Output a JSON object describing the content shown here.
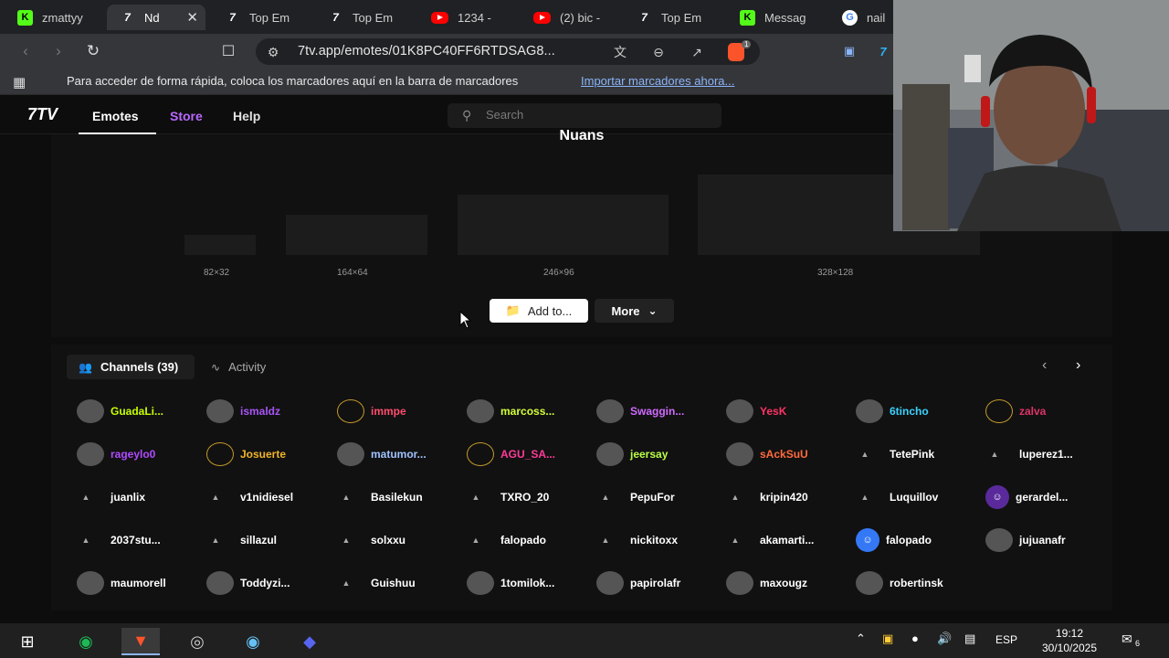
{
  "browser": {
    "tabs": [
      {
        "label": "zmattyy",
        "favicon": "kick-icon",
        "active": false
      },
      {
        "label": "Nd",
        "favicon": "7tv-icon",
        "active": true
      },
      {
        "label": "Top Em",
        "favicon": "7tv-icon",
        "active": false
      },
      {
        "label": "Top Em",
        "favicon": "7tv-icon",
        "active": false
      },
      {
        "label": "1234 -",
        "favicon": "youtube-icon",
        "active": false
      },
      {
        "label": "(2) bic -",
        "favicon": "youtube-icon",
        "active": false
      },
      {
        "label": "Top Em",
        "favicon": "7tv-icon",
        "active": false
      },
      {
        "label": "Messag",
        "favicon": "kick-icon",
        "active": false
      },
      {
        "label": "nail",
        "favicon": "google-icon",
        "active": false
      }
    ],
    "url": "7tv.app/emotes/01K8PC40FF6RTDSAG8...",
    "bookmarks_message": "Para acceder de forma rápida, coloca los marcadores aquí en la barra de marcadores",
    "bookmarks_import": "Importar marcadores ahora...",
    "shield_badge": "1"
  },
  "site": {
    "logo": "7TV",
    "nav": {
      "emotes": "Emotes",
      "store": "Store",
      "help": "Help"
    },
    "search_placeholder": "Search",
    "colors": {
      "store": "#b967ff",
      "background": "#0d0d0d",
      "panel": "#111111"
    }
  },
  "emote": {
    "name": "Nuans",
    "sizes": [
      "82×32",
      "164×64",
      "246×96",
      "328×128"
    ],
    "add_label": "Add to...",
    "more_label": "More"
  },
  "channels": {
    "tab_channels": "Channels (39)",
    "tab_activity": "Activity",
    "items": [
      {
        "name": "GuadaLi...",
        "color": "#c6ff00",
        "avatar": "photo"
      },
      {
        "name": "ismaldz",
        "color": "#a855f7",
        "avatar": "photo"
      },
      {
        "name": "immpe",
        "color": "#ff4d6d",
        "avatar": "ring"
      },
      {
        "name": "marcoss...",
        "color": "#d4ff3b",
        "avatar": "photo"
      },
      {
        "name": "Swaggin...",
        "color": "#d06bff",
        "avatar": "photo"
      },
      {
        "name": "YesK",
        "color": "#ff3366",
        "avatar": "photo"
      },
      {
        "name": "6tincho",
        "color": "#3ad3ff",
        "avatar": "photo"
      },
      {
        "name": "zalva",
        "color": "#e0336a",
        "avatar": "ring"
      },
      {
        "name": "rageylo0",
        "color": "#b04bff",
        "avatar": "photo"
      },
      {
        "name": "Josuerte",
        "color": "#f0b429",
        "avatar": "ring"
      },
      {
        "name": "matumor...",
        "color": "#9fc3ff",
        "avatar": "photo"
      },
      {
        "name": "AGU_SA...",
        "color": "#ff3b9a",
        "avatar": "ring"
      },
      {
        "name": "jeersay",
        "color": "#b9ff45",
        "avatar": "photo"
      },
      {
        "name": "sAckSuU",
        "color": "#ff6a3d",
        "avatar": "photo"
      },
      {
        "name": "TetePink",
        "color": "#ffffff",
        "avatar": "none"
      },
      {
        "name": "luperez1...",
        "color": "#ffffff",
        "avatar": "none"
      },
      {
        "name": "juanlix",
        "color": "#ffffff",
        "avatar": "none"
      },
      {
        "name": "v1nidiesel",
        "color": "#ffffff",
        "avatar": "none"
      },
      {
        "name": "Basilekun",
        "color": "#ffffff",
        "avatar": "none"
      },
      {
        "name": "TXRO_20",
        "color": "#ffffff",
        "avatar": "none"
      },
      {
        "name": "PepuFor",
        "color": "#ffffff",
        "avatar": "none"
      },
      {
        "name": "kripin420",
        "color": "#ffffff",
        "avatar": "none"
      },
      {
        "name": "Luquillov",
        "color": "#ffffff",
        "avatar": "none"
      },
      {
        "name": "gerardel...",
        "color": "#ffffff",
        "avatar": "purple"
      },
      {
        "name": "2037stu...",
        "color": "#ffffff",
        "avatar": "none"
      },
      {
        "name": "sillazul",
        "color": "#ffffff",
        "avatar": "none"
      },
      {
        "name": "solxxu",
        "color": "#ffffff",
        "avatar": "none"
      },
      {
        "name": "falopado",
        "color": "#ffffff",
        "avatar": "none"
      },
      {
        "name": "nickitoxx",
        "color": "#ffffff",
        "avatar": "none"
      },
      {
        "name": "akamarti...",
        "color": "#ffffff",
        "avatar": "none"
      },
      {
        "name": "falopado",
        "color": "#ffffff",
        "avatar": "blue"
      },
      {
        "name": "jujuanafr",
        "color": "#ffffff",
        "avatar": "photo"
      },
      {
        "name": "maumorell",
        "color": "#ffffff",
        "avatar": "photo"
      },
      {
        "name": "Toddyzi...",
        "color": "#ffffff",
        "avatar": "photo"
      },
      {
        "name": "Guishuu",
        "color": "#ffffff",
        "avatar": "none"
      },
      {
        "name": "1tomilok...",
        "color": "#ffffff",
        "avatar": "photo"
      },
      {
        "name": "papirolafr",
        "color": "#ffffff",
        "avatar": "photo"
      },
      {
        "name": "maxougz",
        "color": "#ffffff",
        "avatar": "photo"
      },
      {
        "name": "robertinsk",
        "color": "#ffffff",
        "avatar": "photo"
      }
    ]
  },
  "taskbar": {
    "language": "ESP",
    "time": "19:12",
    "date": "30/10/2025",
    "notifications": "6"
  }
}
